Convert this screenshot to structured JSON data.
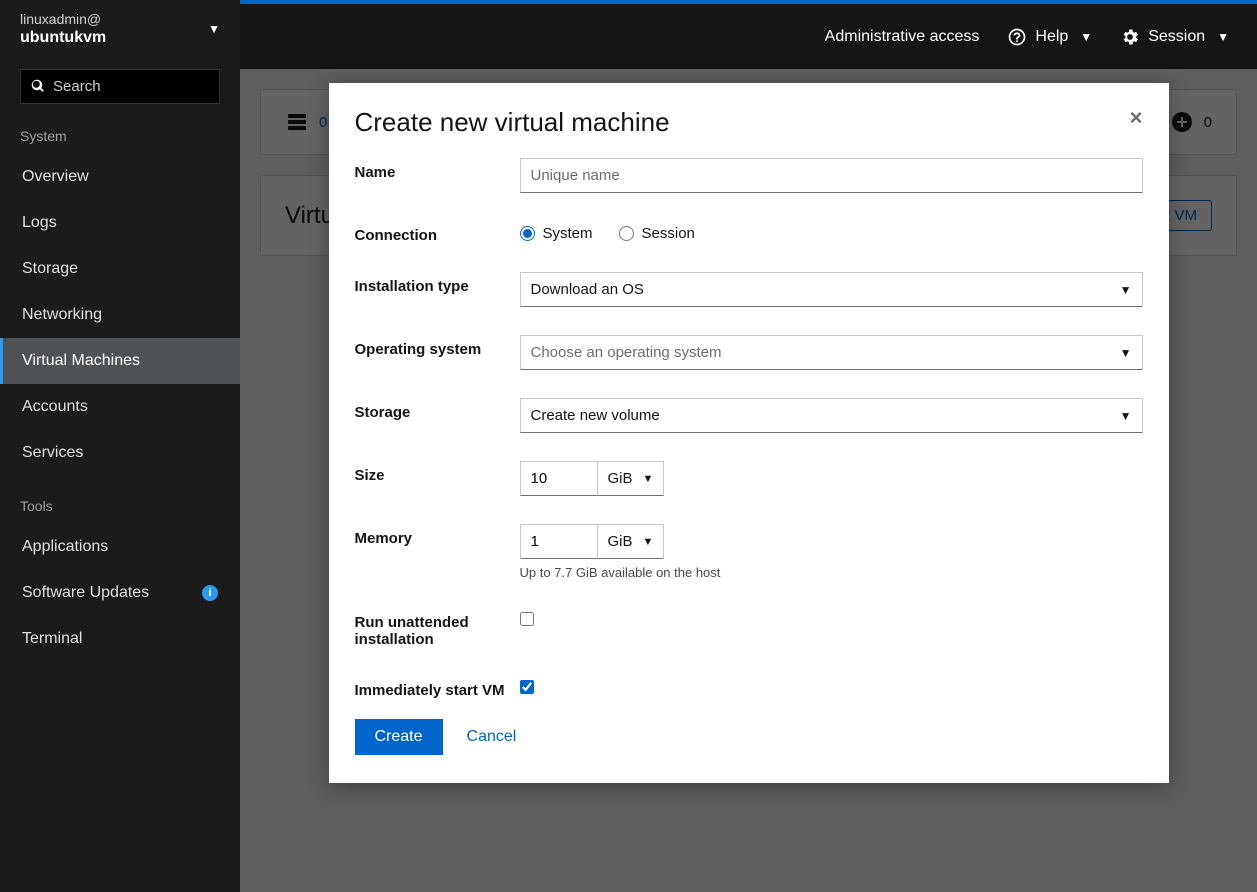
{
  "sidebar": {
    "user": "linuxadmin@",
    "host": "ubuntukvm",
    "search_placeholder": "Search",
    "sections": {
      "system": {
        "label": "System",
        "items": [
          "Overview",
          "Logs",
          "Storage",
          "Networking",
          "Virtual Machines",
          "Accounts",
          "Services"
        ]
      },
      "tools": {
        "label": "Tools",
        "items": [
          "Applications",
          "Software Updates",
          "Terminal"
        ]
      }
    },
    "active_item": "Virtual Machines"
  },
  "topbar": {
    "admin_access": "Administrative access",
    "help": "Help",
    "session": "Session"
  },
  "stats": {
    "left_count": "0",
    "right_count": "0"
  },
  "vm_section": {
    "title": "Virtual machines",
    "import_btn": "Import VM"
  },
  "modal": {
    "title": "Create new virtual machine",
    "labels": {
      "name": "Name",
      "connection": "Connection",
      "install_type": "Installation type",
      "os": "Operating system",
      "storage": "Storage",
      "size": "Size",
      "memory": "Memory",
      "unattended": "Run unattended installation",
      "start_vm": "Immediately start VM"
    },
    "name_placeholder": "Unique name",
    "connection": {
      "system": "System",
      "session": "Session"
    },
    "install_type_value": "Download an OS",
    "os_placeholder": "Choose an operating system",
    "storage_value": "Create new volume",
    "size_value": "10",
    "size_unit": "GiB",
    "memory_value": "1",
    "memory_unit": "GiB",
    "memory_helper": "Up to 7.7 GiB available on the host",
    "unattended_checked": false,
    "start_vm_checked": true,
    "create_btn": "Create",
    "cancel_btn": "Cancel"
  }
}
